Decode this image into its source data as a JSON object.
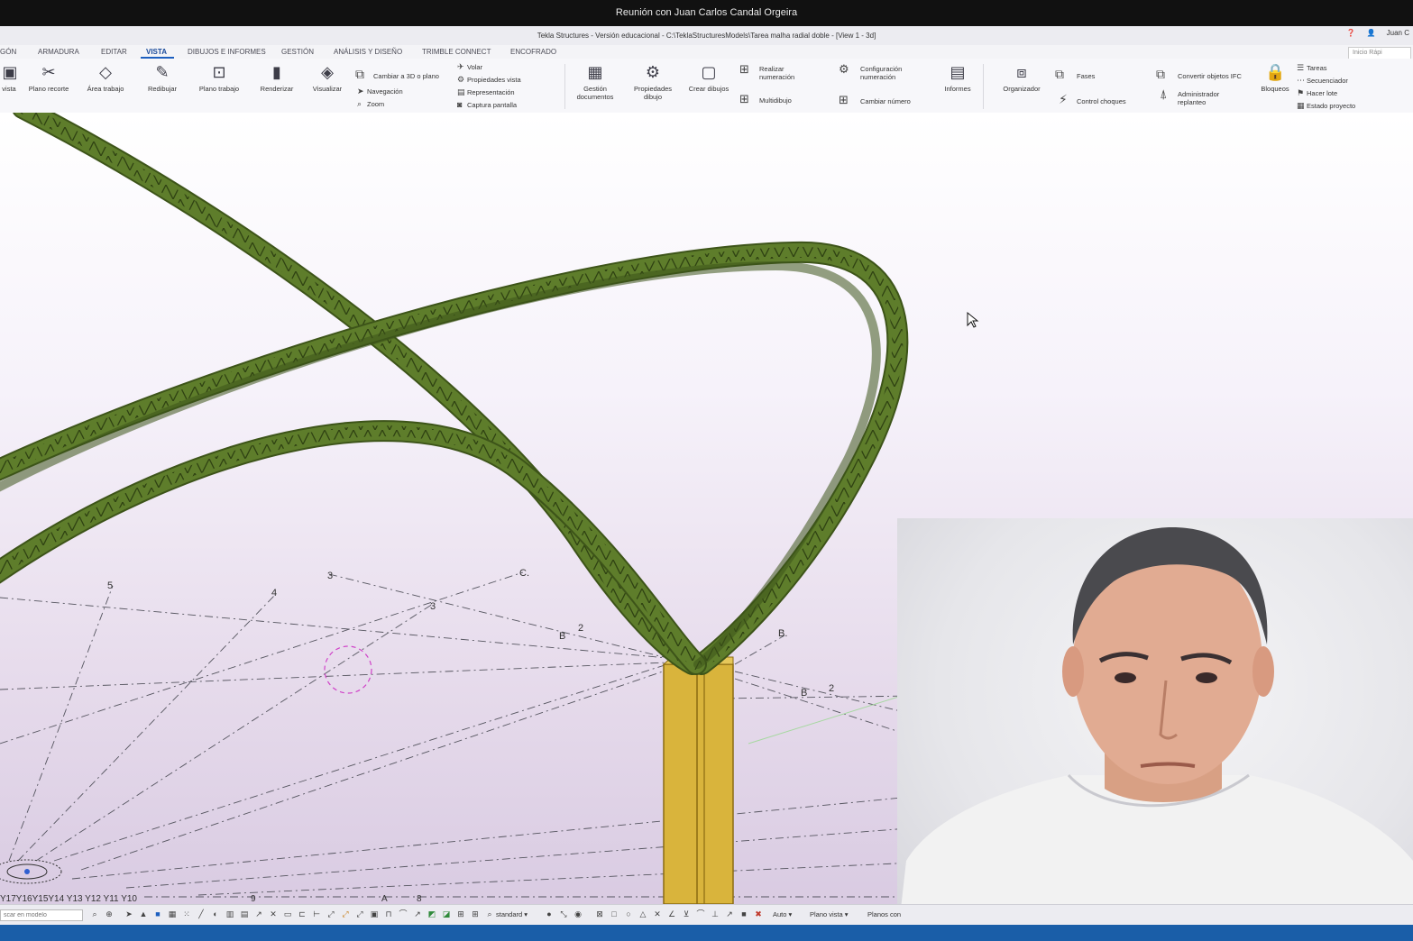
{
  "meeting": {
    "title": "Reunión con Juan Carlos Candal Orgeira"
  },
  "app": {
    "title": "Tekla Structures - Versión educacional - C:\\TeklaStructuresModels\\Tarea malha radial doble - [View 1 - 3d]",
    "user": "Juan C",
    "quick_launch_placeholder": "Inicio Rápi"
  },
  "tabs": [
    {
      "label": "GÓN"
    },
    {
      "label": "ARMADURA"
    },
    {
      "label": "EDITAR"
    },
    {
      "label": "VISTA",
      "active": true
    },
    {
      "label": "DIBUJOS E INFORMES"
    },
    {
      "label": "GESTIÓN"
    },
    {
      "label": "ANÁLISIS Y DISEÑO"
    },
    {
      "label": "TRIMBLE CONNECT"
    },
    {
      "label": "ENCOFRADO"
    }
  ],
  "ribbon": {
    "vista": "vista",
    "plano_recorte": "Plano recorte",
    "area_trabajo": "Área trabajo",
    "redibujar": "Redibujar",
    "plano_trabajo": "Plano trabajo",
    "renderizar": "Renderizar",
    "visualizar": "Visualizar",
    "cambiar_3d": "Cambiar a 3D o plano",
    "navegacion": "Navegación",
    "zoom": "Zoom",
    "volar": "Volar",
    "propiedades_vista": "Propiedades vista",
    "representacion": "Representación",
    "captura": "Captura pantalla",
    "gestion_doc_1": "Gestión",
    "gestion_doc_2": "documentos",
    "prop_dibujo_1": "Propiedades",
    "prop_dibujo_2": "dibujo",
    "crear_dibujos": "Crear dibujos",
    "realizar_num_1": "Realizar",
    "realizar_num_2": "numeración",
    "multidibujo": "Multidibujo",
    "config_num_1": "Configuración",
    "config_num_2": "numeración",
    "cambiar_numero": "Cambiar número",
    "informes": "Informes",
    "organizador": "Organizador",
    "fases": "Fases",
    "control_choques": "Control choques",
    "convertir_ifc": "Convertir objetos IFC",
    "admin_1": "Administrador",
    "admin_2": "replanteo",
    "bloqueos": "Bloqueos",
    "tareas": "Tareas",
    "secuenciador": "Secuenciador",
    "hacer_lote": "Hacer lote",
    "estado_proyecto": "Estado proyecto"
  },
  "grid_labels": {
    "l5": "5",
    "l4a": "4",
    "l3a": "3",
    "lC": "C.",
    "l3b": "3",
    "lB1": "B",
    "l2a": "2",
    "lB2": "B.",
    "lB3": "B",
    "l2b": "2",
    "lA1": "A",
    "l3c": "3",
    "l3d": "3",
    "l4b": "4",
    "bottom": "Y17Y16Y15Y14 Y13  Y12    Y11       Y10",
    "b9": "9",
    "bA": "A",
    "b8": "8"
  },
  "bottom_toolbar": {
    "find_placeholder": "scar en modelo",
    "standard": "standard",
    "auto": "Auto",
    "plano_vista": "Plano vista",
    "planos_con": "Planos con"
  },
  "colors": {
    "truss": "#5e7d2b",
    "truss_dark": "#3d5419",
    "column": "#d9b43c",
    "column_dark": "#8a6b12",
    "ribbon_accent": "#1d5fbf",
    "status_blue": "#1a5ea8"
  }
}
